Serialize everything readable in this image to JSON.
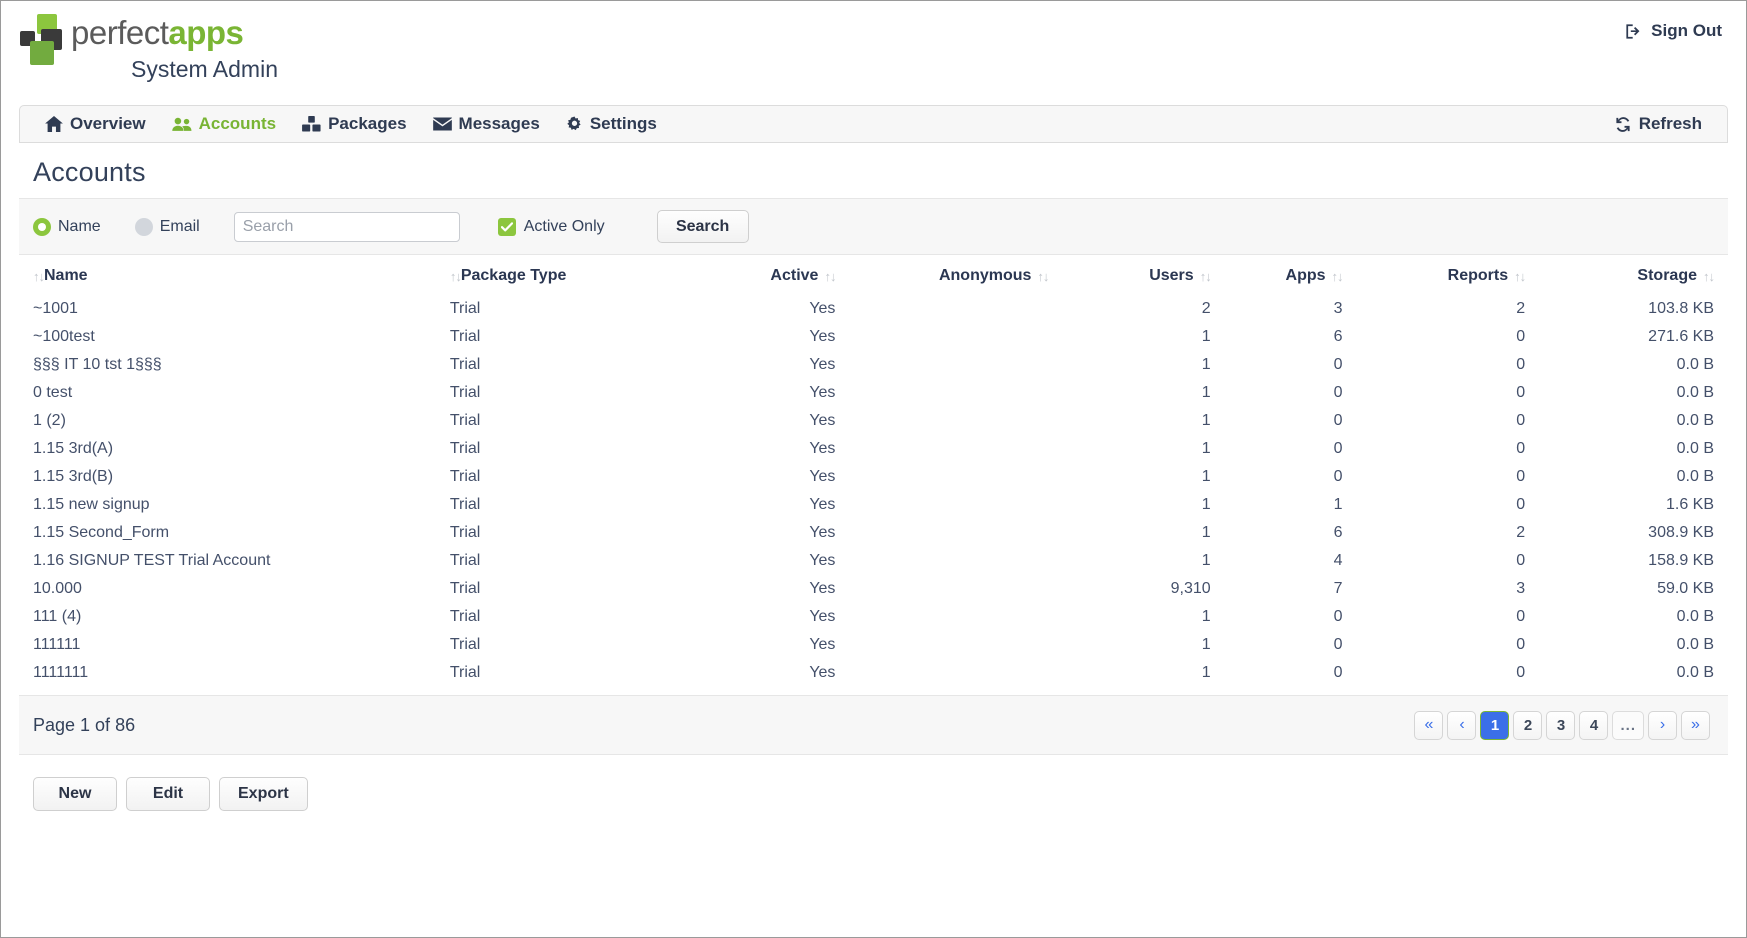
{
  "header": {
    "logo_alt": "perfect apps",
    "wordmark_part1": "perfect",
    "wordmark_part2": "apps",
    "subtitle": "System Admin",
    "signout_label": "Sign Out",
    "signout_icon": "sign-out-icon",
    "brand_green": "#7ab534",
    "brand_dark": "#3a3a3a"
  },
  "nav": {
    "items": [
      {
        "label": "Overview",
        "icon": "home-icon",
        "active": false
      },
      {
        "label": "Accounts",
        "icon": "users-icon",
        "active": true
      },
      {
        "label": "Packages",
        "icon": "boxes-icon",
        "active": false
      },
      {
        "label": "Messages",
        "icon": "envelope-icon",
        "active": false
      },
      {
        "label": "Settings",
        "icon": "gear-icon",
        "active": false
      }
    ],
    "refresh_label": "Refresh",
    "refresh_icon": "refresh-icon",
    "active_color": "#79b434"
  },
  "main": {
    "title": "Accounts",
    "search": {
      "radio_name_label": "Name",
      "radio_email_label": "Email",
      "selected_radio": "Name",
      "input_value": "",
      "input_placeholder": "Search",
      "active_only_label": "Active Only",
      "active_only_checked": true,
      "search_button_label": "Search",
      "accent_color": "#8cc63e"
    },
    "table": {
      "columns": [
        {
          "label": "Name",
          "align": "left",
          "sortable": true
        },
        {
          "label": "Package Type",
          "align": "left",
          "sortable": true
        },
        {
          "label": "Active",
          "align": "right",
          "sortable": true
        },
        {
          "label": "Anonymous",
          "align": "right",
          "sortable": true
        },
        {
          "label": "Users",
          "align": "right",
          "sortable": true
        },
        {
          "label": "Apps",
          "align": "right",
          "sortable": true
        },
        {
          "label": "Reports",
          "align": "right",
          "sortable": true
        },
        {
          "label": "Storage",
          "align": "right",
          "sortable": true
        }
      ],
      "rows": [
        {
          "name": "~1001",
          "package": "Trial",
          "active": "Yes",
          "anonymous": "",
          "users": "2",
          "apps": "3",
          "reports": "2",
          "storage": "103.8 KB"
        },
        {
          "name": "~100test",
          "package": "Trial",
          "active": "Yes",
          "anonymous": "",
          "users": "1",
          "apps": "6",
          "reports": "0",
          "storage": "271.6 KB"
        },
        {
          "name": "§§§ IT 10 tst 1§§§",
          "package": "Trial",
          "active": "Yes",
          "anonymous": "",
          "users": "1",
          "apps": "0",
          "reports": "0",
          "storage": "0.0 B"
        },
        {
          "name": "0 test",
          "package": "Trial",
          "active": "Yes",
          "anonymous": "",
          "users": "1",
          "apps": "0",
          "reports": "0",
          "storage": "0.0 B"
        },
        {
          "name": "1 (2)",
          "package": "Trial",
          "active": "Yes",
          "anonymous": "",
          "users": "1",
          "apps": "0",
          "reports": "0",
          "storage": "0.0 B"
        },
        {
          "name": "1.15 3rd(A)",
          "package": "Trial",
          "active": "Yes",
          "anonymous": "",
          "users": "1",
          "apps": "0",
          "reports": "0",
          "storage": "0.0 B"
        },
        {
          "name": "1.15 3rd(B)",
          "package": "Trial",
          "active": "Yes",
          "anonymous": "",
          "users": "1",
          "apps": "0",
          "reports": "0",
          "storage": "0.0 B"
        },
        {
          "name": "1.15 new signup",
          "package": "Trial",
          "active": "Yes",
          "anonymous": "",
          "users": "1",
          "apps": "1",
          "reports": "0",
          "storage": "1.6 KB"
        },
        {
          "name": "1.15 Second_Form",
          "package": "Trial",
          "active": "Yes",
          "anonymous": "",
          "users": "1",
          "apps": "6",
          "reports": "2",
          "storage": "308.9 KB"
        },
        {
          "name": "1.16 SIGNUP TEST Trial Account",
          "package": "Trial",
          "active": "Yes",
          "anonymous": "",
          "users": "1",
          "apps": "4",
          "reports": "0",
          "storage": "158.9 KB"
        },
        {
          "name": "10.000",
          "package": "Trial",
          "active": "Yes",
          "anonymous": "",
          "users": "9,310",
          "apps": "7",
          "reports": "3",
          "storage": "59.0 KB"
        },
        {
          "name": "111 (4)",
          "package": "Trial",
          "active": "Yes",
          "anonymous": "",
          "users": "1",
          "apps": "0",
          "reports": "0",
          "storage": "0.0 B"
        },
        {
          "name": "111111",
          "package": "Trial",
          "active": "Yes",
          "anonymous": "",
          "users": "1",
          "apps": "0",
          "reports": "0",
          "storage": "0.0 B"
        },
        {
          "name": "1111111",
          "package": "Trial",
          "active": "Yes",
          "anonymous": "",
          "users": "1",
          "apps": "0",
          "reports": "0",
          "storage": "0.0 B"
        }
      ]
    },
    "pager": {
      "label": "Page 1 of 86",
      "first_label": "«",
      "prev_label": "‹",
      "pages": [
        "1",
        "2",
        "3",
        "4"
      ],
      "current_page": "1",
      "ellipsis": "...",
      "next_label": "›",
      "last_label": "»",
      "current_bg": "#3b6fe8",
      "current_border": "#7ab534"
    },
    "actions": [
      {
        "label": "New"
      },
      {
        "label": "Edit"
      },
      {
        "label": "Export"
      }
    ]
  }
}
